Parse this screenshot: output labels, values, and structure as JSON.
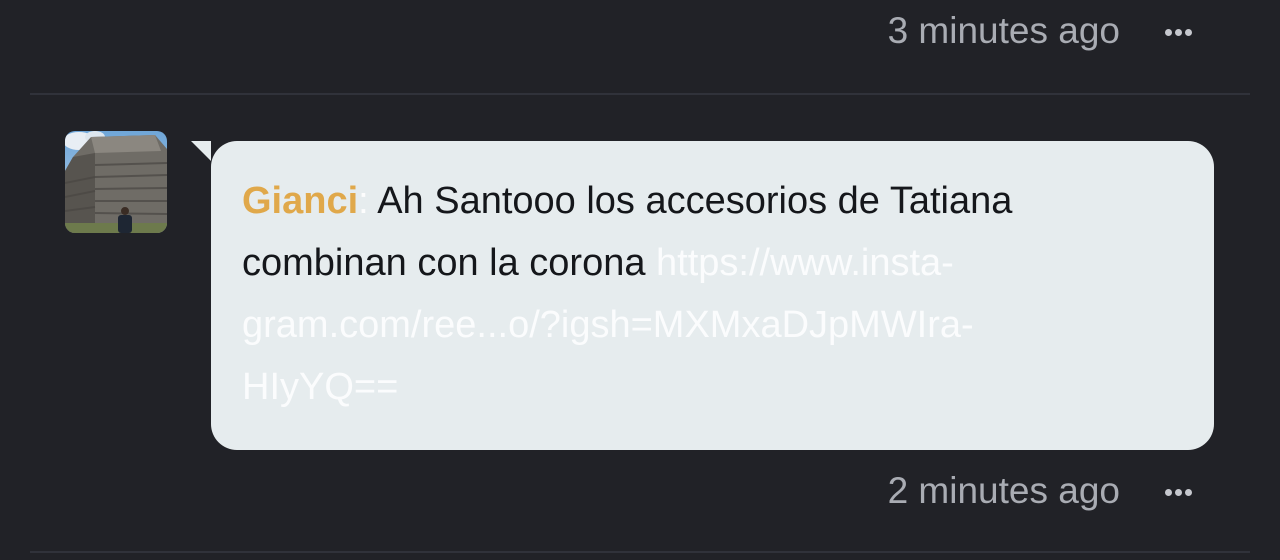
{
  "previous_message": {
    "timestamp": "3 minutes ago",
    "more_icon": "ellipsis-horizontal-icon"
  },
  "message": {
    "author": "Gianci",
    "separator": ":",
    "text": "Ah Santooo los accesorios de Tatiana combinan con la corona",
    "link_line1": "https://www.insta-",
    "link_line2": "gram.com/ree...o/?igsh=MXMxaDJpMWIra-",
    "link_line3": "HIyYQ==",
    "timestamp": "2 minutes ago",
    "more_icon": "ellipsis-horizontal-icon",
    "avatar_icon": "user-avatar-photo"
  },
  "colors": {
    "background": "#212227",
    "bubble": "#e6ecee",
    "author": "#e0a84a",
    "timestamp": "#a9acb3"
  }
}
